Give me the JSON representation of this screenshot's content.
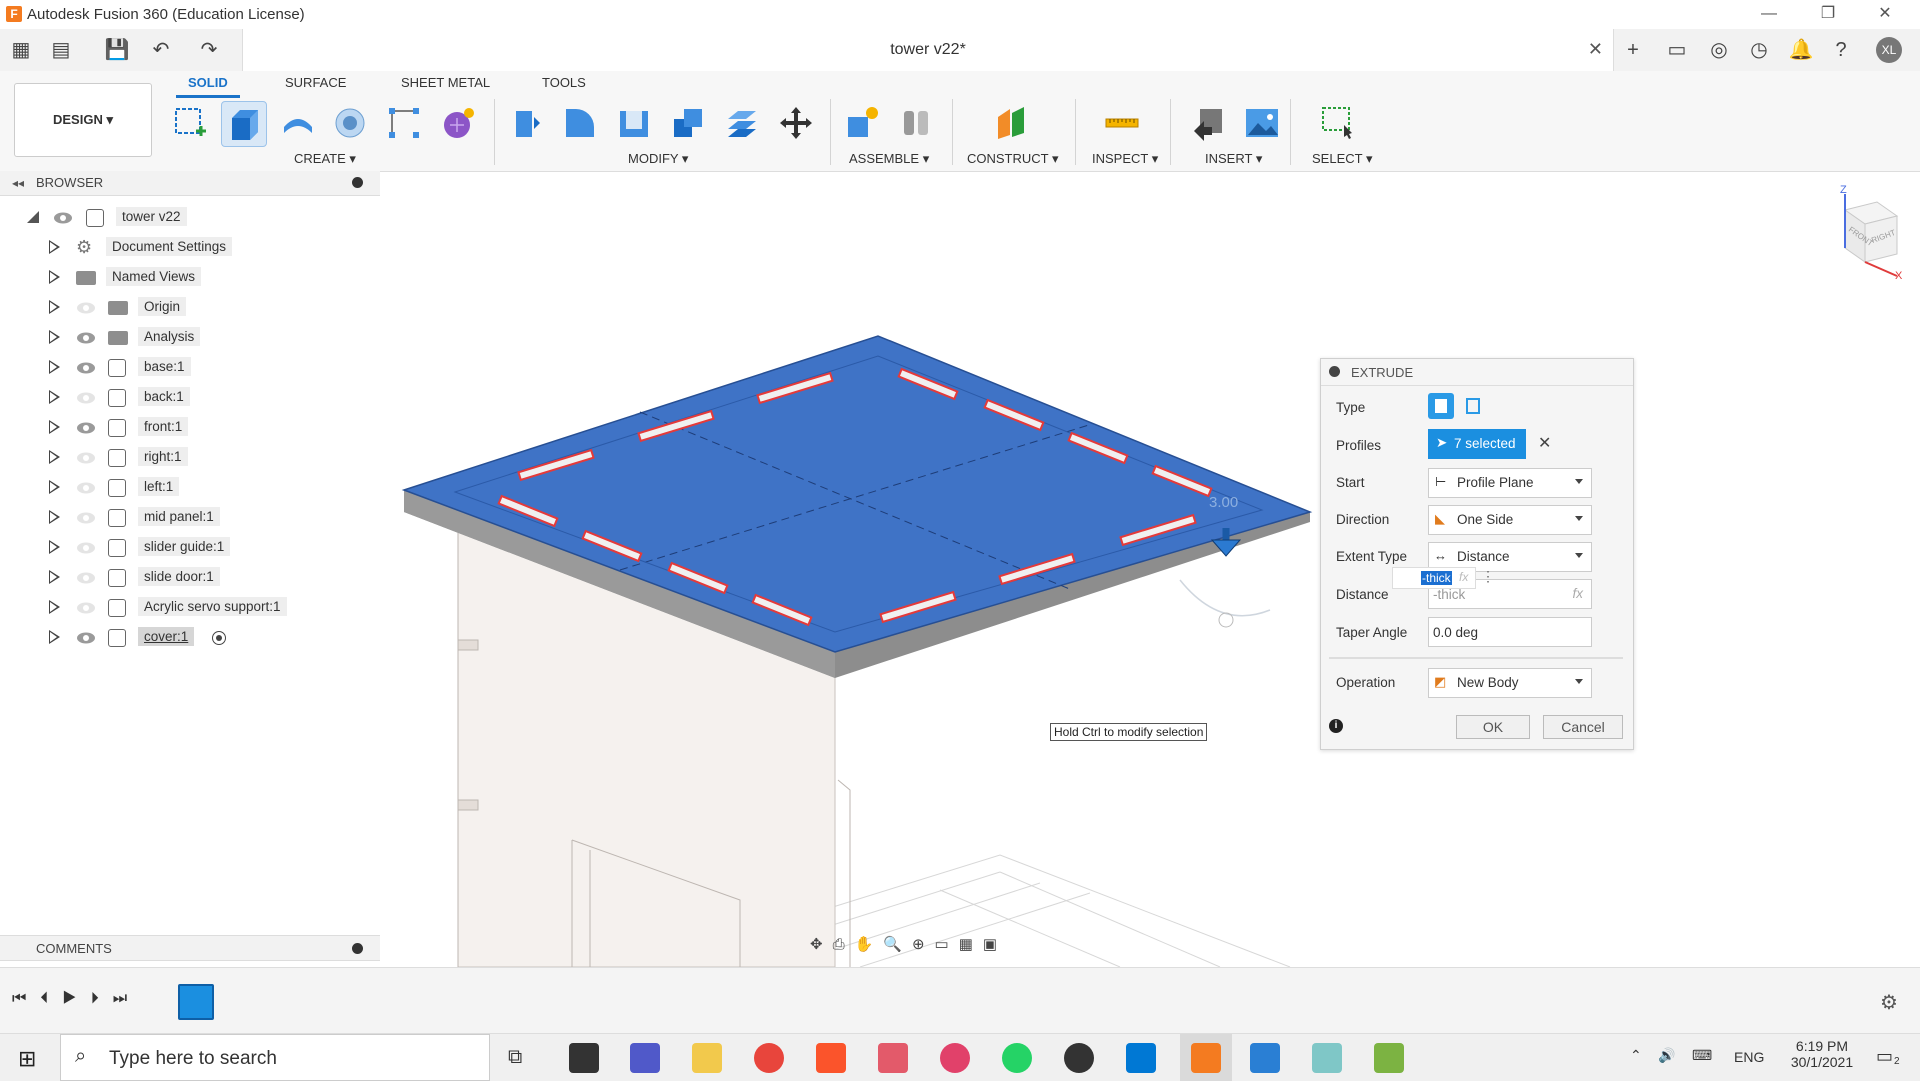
{
  "window": {
    "title": "Autodesk Fusion 360 (Education License)",
    "minimize": "—",
    "restore": "❐",
    "close": "✕"
  },
  "quickbar": {
    "doc_title": "tower v22*",
    "doc_close": "✕",
    "user_initials": "XL"
  },
  "toolbar": {
    "workspace": "DESIGN ▾",
    "tabs": [
      "SOLID",
      "SURFACE",
      "SHEET METAL",
      "TOOLS"
    ],
    "groups": [
      "CREATE ▾",
      "MODIFY ▾",
      "ASSEMBLE ▾",
      "CONSTRUCT ▾",
      "INSPECT ▾",
      "INSERT ▾",
      "SELECT ▾"
    ]
  },
  "browser": {
    "header": "BROWSER",
    "root": "tower v22",
    "items": [
      {
        "label": "Document Settings",
        "icon": "gear-icon"
      },
      {
        "label": "Named Views",
        "icon": "folder-icon"
      },
      {
        "label": "Origin",
        "icon": "folder-icon"
      },
      {
        "label": "Analysis",
        "icon": "folder-icon"
      },
      {
        "label": "base:1",
        "icon": "component-icon"
      },
      {
        "label": "back:1",
        "icon": "component-icon"
      },
      {
        "label": "front:1",
        "icon": "component-icon"
      },
      {
        "label": "right:1",
        "icon": "component-icon"
      },
      {
        "label": "left:1",
        "icon": "component-icon"
      },
      {
        "label": "mid panel:1",
        "icon": "component-icon"
      },
      {
        "label": "slider guide:1",
        "icon": "component-icon"
      },
      {
        "label": "slide door:1",
        "icon": "component-icon"
      },
      {
        "label": "Acrylic servo support:1",
        "icon": "component-icon"
      },
      {
        "label": "cover:1",
        "icon": "component-icon"
      }
    ]
  },
  "comments": {
    "header": "COMMENTS"
  },
  "viewport": {
    "hint": "Hold Ctrl to modify selection",
    "dimension": "3.00",
    "viewcube": {
      "front": "FRONT",
      "right": "RIGHT",
      "z": "Z",
      "x": "X"
    }
  },
  "extrude": {
    "title": "EXTRUDE",
    "labels": {
      "type": "Type",
      "profiles": "Profiles",
      "start": "Start",
      "direction": "Direction",
      "extent": "Extent Type",
      "distance": "Distance",
      "taper": "Taper Angle",
      "operation": "Operation"
    },
    "profiles_value": "7 selected",
    "start_value": "Profile Plane",
    "direction_value": "One Side",
    "extent_value": "Distance",
    "distance_value": "-thick",
    "distance_edit": "-thick",
    "fx": "fx",
    "taper_value": "0.0 deg",
    "operation_value": "New Body",
    "ok": "OK",
    "cancel": "Cancel"
  },
  "taskbar": {
    "search_placeholder": "Type here to search",
    "lang": "ENG",
    "time": "6:19 PM",
    "date": "30/1/2021",
    "notifications": "2"
  }
}
